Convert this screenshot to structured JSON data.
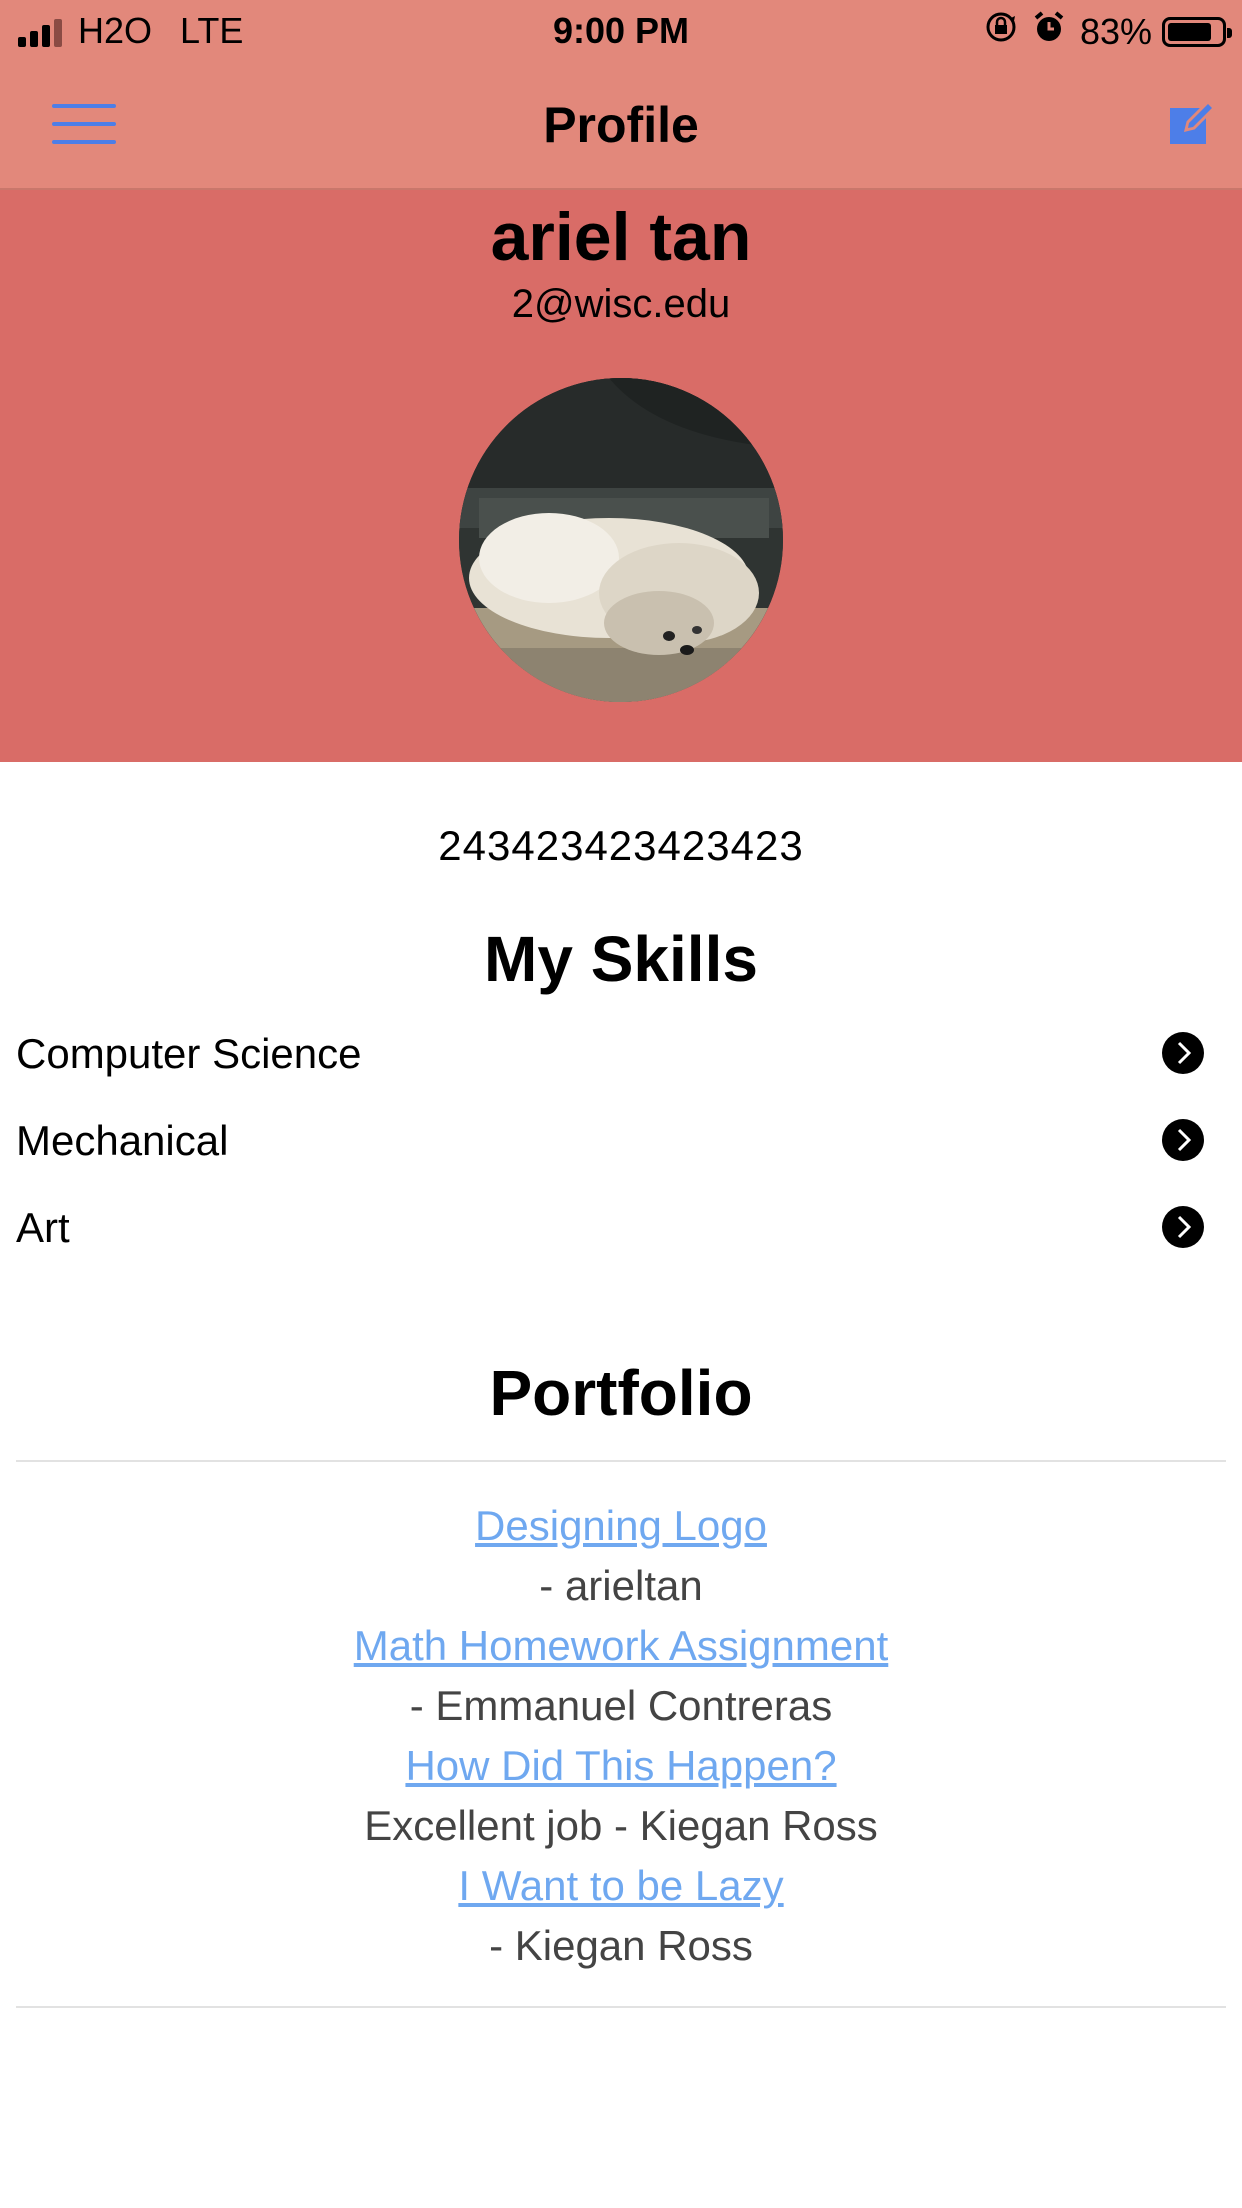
{
  "status_bar": {
    "carrier": "H2O",
    "network": "LTE",
    "time": "9:00 PM",
    "battery": "83%",
    "battery_level": 0.83
  },
  "nav": {
    "title": "Profile",
    "menu_icon": "hamburger-menu-icon",
    "edit_icon": "edit-icon",
    "accent_color": "#4d7ee8"
  },
  "profile": {
    "name": "ariel tan",
    "email": "2@wisc.edu",
    "phone": "243423423423423",
    "header_color": "#d96c67"
  },
  "skills": {
    "title": "My Skills",
    "items": [
      {
        "label": "Computer Science"
      },
      {
        "label": "Mechanical"
      },
      {
        "label": "Art"
      }
    ]
  },
  "portfolio": {
    "title": "Portfolio",
    "items": [
      {
        "title": "Designing Logo",
        "caption": "- arieltan"
      },
      {
        "title": "Math Homework Assignment",
        "caption": "- Emmanuel Contreras"
      },
      {
        "title": "How Did This Happen?",
        "caption": "Excellent job - Kiegan Ross"
      },
      {
        "title": "I Want to be Lazy",
        "caption": "- Kiegan Ross"
      }
    ]
  }
}
